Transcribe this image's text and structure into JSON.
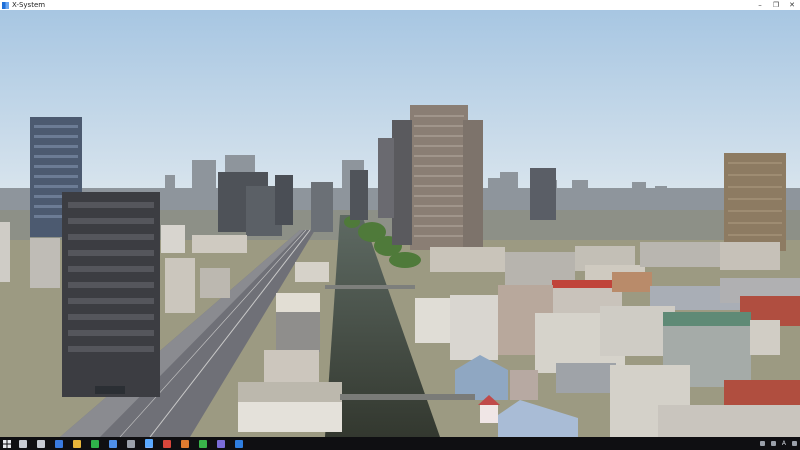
{
  "window": {
    "title": "X-System",
    "controls": {
      "minimize": "–",
      "restore": "❐",
      "close": "✕"
    }
  },
  "scene": {
    "colors": {
      "sky_top": "#a7c6e2",
      "sky_bottom": "#d7e3ec",
      "river": "#3b3f38",
      "ground": "#9c9a82",
      "highway": "#6f7077"
    }
  },
  "taskbar": {
    "start_icon": "windows-start-icon",
    "icons": [
      {
        "name": "search-icon",
        "color": "#c8ccd4"
      },
      {
        "name": "task-view-icon",
        "color": "#c8ccd4"
      },
      {
        "name": "edge-browser-icon",
        "color": "#3a7be0"
      },
      {
        "name": "file-explorer-icon",
        "color": "#e8b63a"
      },
      {
        "name": "green-app-icon",
        "color": "#2fb34a"
      },
      {
        "name": "store-icon",
        "color": "#4f8fe8"
      },
      {
        "name": "settings-icon",
        "color": "#9aa0aa"
      },
      {
        "name": "xplane-icon",
        "color": "#5aa9ff"
      },
      {
        "name": "red-app-icon",
        "color": "#d9463b"
      },
      {
        "name": "orange-app-icon",
        "color": "#e07b2f"
      },
      {
        "name": "chat-app-icon",
        "color": "#39b54a"
      },
      {
        "name": "media-app-icon",
        "color": "#7a6cd9"
      },
      {
        "name": "ie-browser-icon",
        "color": "#2f7ee0"
      }
    ],
    "tray": {
      "language": "A"
    }
  }
}
